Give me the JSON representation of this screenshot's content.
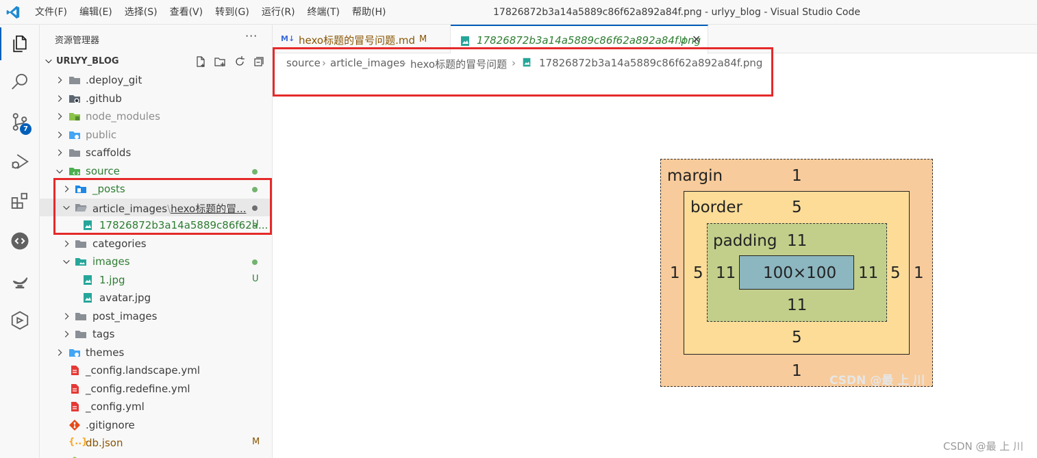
{
  "menu": [
    "文件(F)",
    "编辑(E)",
    "选择(S)",
    "查看(V)",
    "转到(G)",
    "运行(R)",
    "终端(T)",
    "帮助(H)"
  ],
  "window_title": "17826872b3a14a5889c86f62a892a84f.png - urlyy_blog - Visual Studio Code",
  "activity": {
    "scm_badge": "7"
  },
  "sidebar": {
    "title": "资源管理器",
    "more": "···",
    "project": "URLYY_BLOG"
  },
  "tree": [
    {
      "label": ".deploy_git",
      "status": ""
    },
    {
      "label": ".github",
      "status": ""
    },
    {
      "label": "node_modules",
      "status": ""
    },
    {
      "label": "public",
      "status": ""
    },
    {
      "label": "scaffolds",
      "status": ""
    },
    {
      "label": "source",
      "status": ""
    },
    {
      "label": "_posts",
      "status": ""
    },
    {
      "label": "article_images",
      "sep": "\\",
      "label2": "hexo标题的冒...",
      "status": ""
    },
    {
      "label": "17826872b3a14a5889c86f62a...",
      "status": "U"
    },
    {
      "label": "categories",
      "status": ""
    },
    {
      "label": "images",
      "status": ""
    },
    {
      "label": "1.jpg",
      "status": "U"
    },
    {
      "label": "avatar.jpg",
      "status": ""
    },
    {
      "label": "post_images",
      "status": ""
    },
    {
      "label": "tags",
      "status": ""
    },
    {
      "label": "themes",
      "status": ""
    },
    {
      "label": "_config.landscape.yml",
      "status": ""
    },
    {
      "label": "_config.redefine.yml",
      "status": ""
    },
    {
      "label": "_config.yml",
      "status": ""
    },
    {
      "label": ".gitignore",
      "status": ""
    },
    {
      "label": "db.json",
      "status": "M"
    }
  ],
  "tabs": [
    {
      "icon": "M↓",
      "label": "hexo标题的冒号问题.md",
      "status": "M"
    },
    {
      "label": "17826872b3a14a5889c86f62a892a84f.png",
      "status": "U",
      "close": "✕"
    }
  ],
  "breadcrumb": [
    "source",
    "article_images",
    "hexo标题的冒号问题",
    "17826872b3a14a5889c86f62a892a84f.png"
  ],
  "box_model": {
    "margin_label": "margin",
    "margin": "1",
    "border_label": "border",
    "border": "5",
    "padding_label": "padding",
    "padding": "11",
    "content": "100×100"
  },
  "watermark_inner": "CSDN @最 上 川",
  "watermark_outer": "CSDN @最 上 川",
  "colors": {
    "accent": "#005fb8",
    "highlight_box": "#e52929",
    "margin": "#f7cb9b",
    "border": "#fcdc97",
    "padding": "#c2cf8b",
    "content": "#8cb6c0"
  }
}
